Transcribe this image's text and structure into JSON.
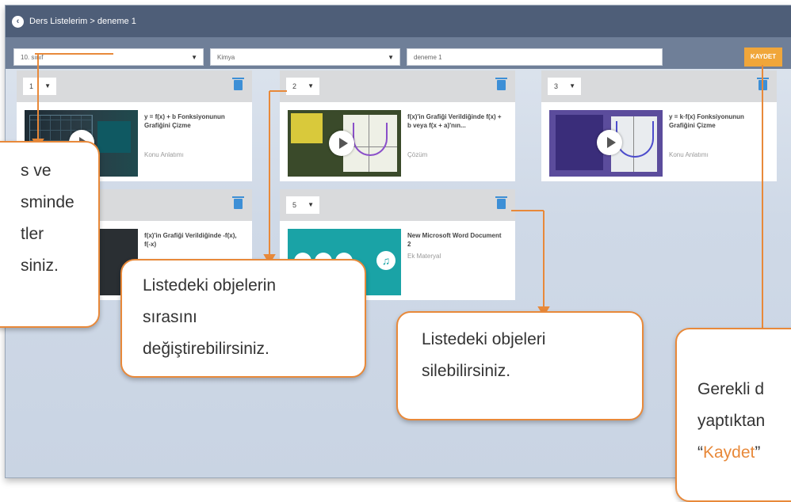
{
  "header": {
    "breadcrumb": "Ders Listelerim > deneme 1",
    "back_icon": "chevron-left-circle-icon"
  },
  "filters": {
    "grade": "10. sınıf",
    "subject": "Kimya",
    "list_name": "deneme 1",
    "save_label": "KAYDET"
  },
  "groups": [
    {
      "order": "1",
      "title": "y = f(x) + b Fonksiyonunun Grafiğini Çizme",
      "type": "Konu Anlatımı"
    },
    {
      "order": "2",
      "title": "f(x)'in Grafiği Verildiğinde f(x) + b veya f(x + a)'nın...",
      "type": "Çözüm"
    },
    {
      "order": "3",
      "title": "y = k·f(x) Fonksiyonunun Grafiğini Çizme",
      "type": "Konu Anlatımı"
    },
    {
      "order": "",
      "title": "f(x)'in Grafiği Verildiğinde -f(x), f(-x)",
      "type": ""
    },
    {
      "order": "5",
      "title": "New Microsoft Word Document 2",
      "type": "Ek Materyal"
    }
  ],
  "callouts": {
    "left": [
      "s ve",
      "sminde",
      "tler",
      "siniz."
    ],
    "reorder": [
      "Listedeki objelerin",
      "sırasını",
      "değiştirebilirsiniz."
    ],
    "delete": [
      "Listedeki objeleri",
      "silebilirsiniz."
    ],
    "save_prefix": [
      "Gerekli d",
      "yaptıktan"
    ],
    "save_open_quote": "“",
    "save_word": "Kaydet",
    "save_close_quote": "”"
  },
  "colors": {
    "accent": "#e8893a",
    "header_bg": "#4e5e78",
    "filter_bg": "#6f7f98",
    "save_button": "#f0a63a",
    "trash_icon": "#3d8fd6"
  }
}
